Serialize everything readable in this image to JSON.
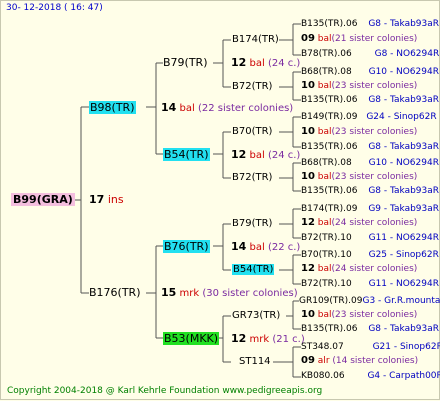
{
  "header": {
    "timestamp": "30- 12-2018 ( 16: 47)"
  },
  "footer": {
    "copyright": "Copyright 2004-2018 @ Karl Kehrle Foundation     www.pedigreeapis.org"
  },
  "root": {
    "name": "B99(GRA)",
    "num": "17",
    "code": "ins"
  },
  "gen1": [
    {
      "name": "B98(TR)",
      "num": "14",
      "code": "bal",
      "note": "(22 sister colonies)"
    },
    {
      "name": "B176(TR)",
      "num": "15",
      "code": "mrk",
      "note": "(30 sister colonies)"
    }
  ],
  "gen2": [
    {
      "name": "B79(TR)",
      "num": "12",
      "code": "bal",
      "note": "(24 c.)"
    },
    {
      "name": "B54(TR)",
      "num": "12",
      "code": "bal",
      "note": "(24 c.)"
    },
    {
      "name": "B76(TR)",
      "num": "14",
      "code": "bal",
      "note": "(22 c.)"
    },
    {
      "name": "B53(MKK)",
      "num": "12",
      "code": "mrk",
      "note": "(21 c.)"
    }
  ],
  "gen3": [
    "B174(TR)",
    "B72(TR)",
    "B70(TR)",
    "B72(TR)",
    "B79(TR)",
    "B54(TR)",
    "GR73(TR)",
    "ST114"
  ],
  "gen4": [
    {
      "sire": "B135(TR).06",
      "sire_note": "G8 - Takab93aR",
      "num": "09",
      "code": "bal",
      "note": "(21 sister colonies)",
      "dam": "B78(TR).06",
      "dam_note": "G8 - NO6294R"
    },
    {
      "sire": "B68(TR).08",
      "sire_note": "G10 - NO6294R",
      "num": "10",
      "code": "bal",
      "note": "(23 sister colonies)",
      "dam": "B135(TR).06",
      "dam_note": "G8 - Takab93aR"
    },
    {
      "sire": "B149(TR).09",
      "sire_note": "G24 - Sinop62R",
      "num": "10",
      "code": "bal",
      "note": "(23 sister colonies)",
      "dam": "B135(TR).06",
      "dam_note": "G8 - Takab93aR"
    },
    {
      "sire": "B68(TR).08",
      "sire_note": "G10 - NO6294R",
      "num": "10",
      "code": "bal",
      "note": "(23 sister colonies)",
      "dam": "B135(TR).06",
      "dam_note": "G8 - Takab93aR"
    },
    {
      "sire": "B174(TR).09",
      "sire_note": "G9 - Takab93aR",
      "num": "12",
      "code": "bal",
      "note": "(24 sister colonies)",
      "dam": "B72(TR).10",
      "dam_note": "G11 - NO6294R"
    },
    {
      "sire": "B70(TR).10",
      "sire_note": "G25 - Sinop62R",
      "num": "12",
      "code": "bal",
      "note": "(24 sister colonies)",
      "dam": "B72(TR).10",
      "dam_note": "G11 - NO6294R"
    },
    {
      "sire": "GR109(TR).09",
      "sire_note": "G3 - Gr.R.mounta",
      "num": "10",
      "code": "bal",
      "note": "(23 sister colonies)",
      "dam": "B135(TR).06",
      "dam_note": "G8 - Takab93aR"
    },
    {
      "sire": "ST348.07",
      "sire_note": "G21 - Sinop62R",
      "num": "09",
      "code": "alr",
      "note": "(14 sister colonies)",
      "dam": "KB080.06",
      "dam_note": "G4 - Carpath00R"
    }
  ]
}
